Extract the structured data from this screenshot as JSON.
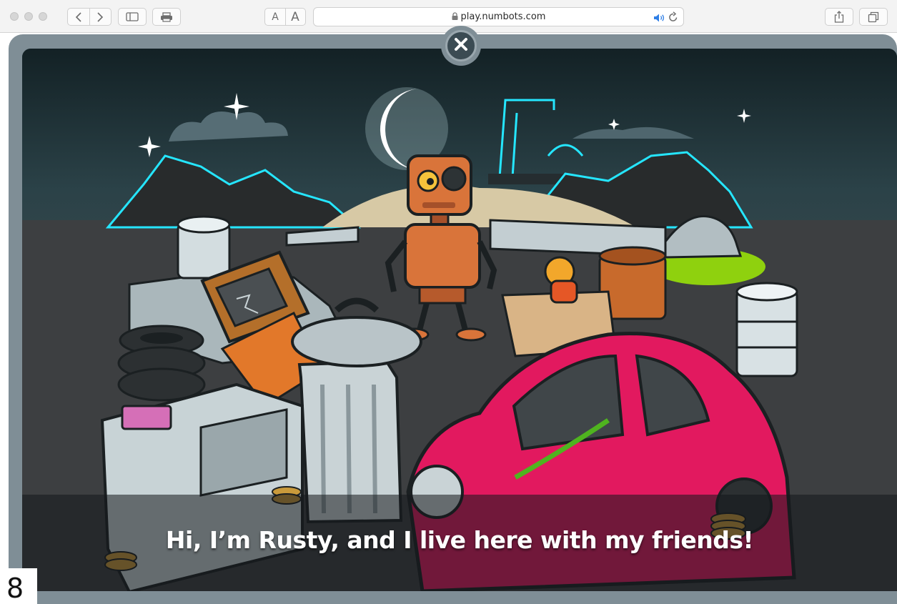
{
  "browser": {
    "address_url": "play.numbots.com",
    "reader_small_a": "A",
    "reader_large_a": "A"
  },
  "game": {
    "subtitle": "Hi, I’m Rusty, and I live here with my friends!"
  },
  "overlay": {
    "page_number": "8"
  },
  "colors": {
    "sky": "#1d3037",
    "robot": "#d9743a",
    "car": "#e2195f",
    "glow": "#25e6ff"
  }
}
